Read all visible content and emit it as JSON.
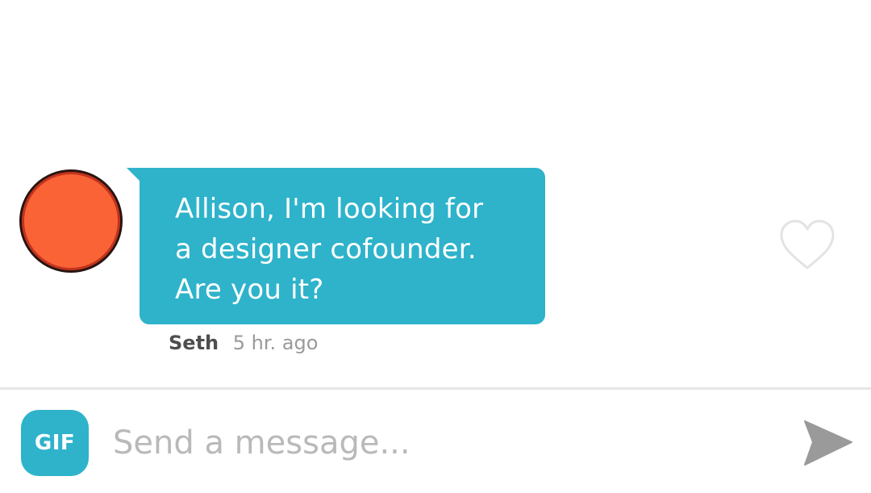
{
  "conversation": {
    "message": {
      "text": "Allison, I'm looking for\na designer cofounder.\nAre you it?",
      "sender": "Seth",
      "time": "5 hr. ago",
      "avatar_color": "#f96336"
    },
    "like_icon": "heart-outline-icon"
  },
  "composer": {
    "gif_label": "GIF",
    "placeholder": "Send a message...",
    "value": "",
    "send_icon": "send-arrow-icon"
  },
  "colors": {
    "accent": "#2eb3cb",
    "bubble_text": "#ffffff",
    "send_icon": "#9a9a9a"
  }
}
